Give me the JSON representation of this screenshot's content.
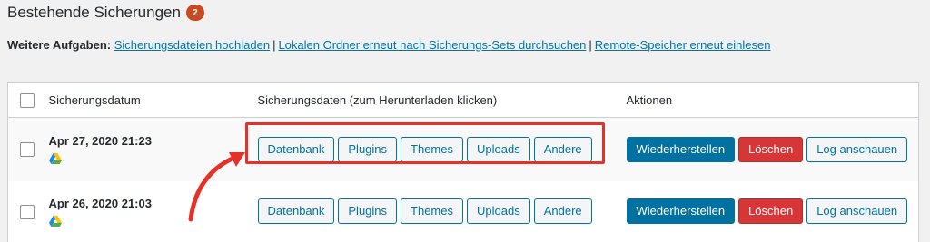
{
  "header": {
    "title": "Bestehende Sicherungen",
    "count": "2"
  },
  "tasks": {
    "label": "Weitere Aufgaben:",
    "links": [
      "Sicherungsdateien hochladen",
      "Lokalen Ordner erneut nach Sicherungs-Sets durchsuchen",
      "Remote-Speicher erneut einlesen"
    ]
  },
  "table": {
    "columns": {
      "date": "Sicherungsdatum",
      "data": "Sicherungsdaten (zum Herunterladen klicken)",
      "actions": "Aktionen"
    },
    "rows": [
      {
        "date": "Apr 27, 2020 21:23",
        "storage_icon": "google-drive-icon",
        "data_buttons": [
          "Datenbank",
          "Plugins",
          "Themes",
          "Uploads",
          "Andere"
        ],
        "actions": {
          "restore": "Wiederherstellen",
          "delete": "Löschen",
          "log": "Log anschauen"
        }
      },
      {
        "date": "Apr 26, 2020 21:03",
        "storage_icon": "google-drive-icon",
        "data_buttons": [
          "Datenbank",
          "Plugins",
          "Themes",
          "Uploads",
          "Andere"
        ],
        "actions": {
          "restore": "Wiederherstellen",
          "delete": "Löschen",
          "log": "Log anschauen"
        }
      }
    ]
  },
  "colors": {
    "accent": "#0071a1",
    "delete": "#d63638",
    "annotation": "#e5312a",
    "badge": "#ca4a1f"
  }
}
